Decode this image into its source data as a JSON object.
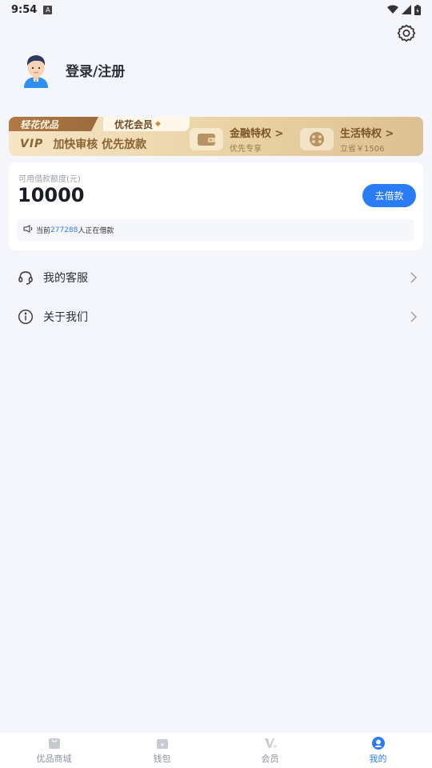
{
  "status_bar": {
    "time": "9:54",
    "notif": "A"
  },
  "header": {
    "login_label": "登录/注册"
  },
  "vip_banner": {
    "brand": "轻花优品",
    "member": "优花会员",
    "vip_word": "VIP",
    "slogan": "加快审核 优先放款",
    "perks": [
      {
        "title": "金融特权 >",
        "sub": "优先专享"
      },
      {
        "title": "生活特权 >",
        "sub": "立省￥1506"
      }
    ]
  },
  "loan_card": {
    "quota_label": "可用借款额度(元)",
    "quota_value": "10000",
    "borrow_label": "去借款",
    "ticker_prefix": "当前",
    "ticker_count": "277288",
    "ticker_suffix": "人正在借款"
  },
  "menu": {
    "items": [
      {
        "label": "我的客服"
      },
      {
        "label": "关于我们"
      }
    ]
  },
  "tab_bar": {
    "tabs": [
      {
        "label": "优品商城"
      },
      {
        "label": "钱包"
      },
      {
        "label": "会员"
      },
      {
        "label": "我的"
      }
    ]
  },
  "colors": {
    "accent": "#2a7cf6",
    "background": "#f5f6fc",
    "vip_gold": "#8a6433"
  }
}
